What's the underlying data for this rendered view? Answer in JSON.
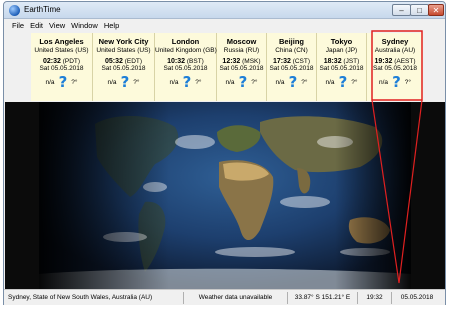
{
  "window": {
    "title": "EarthTime"
  },
  "menu": {
    "items": [
      "File",
      "Edit",
      "View",
      "Window",
      "Help"
    ]
  },
  "cities": [
    {
      "name": "Los Angeles",
      "country": "United States (US)",
      "time": "02:32",
      "zone": "(PDT)",
      "date": "Sat 05.05.2018",
      "weather": "n/a",
      "deg": "?°"
    },
    {
      "name": "New York City",
      "country": "United States (US)",
      "time": "05:32",
      "zone": "(EDT)",
      "date": "Sat 05.05.2018",
      "weather": "n/a",
      "deg": "?°"
    },
    {
      "name": "London",
      "country": "United Kingdom (GB)",
      "time": "10:32",
      "zone": "(BST)",
      "date": "Sat 05.05.2018",
      "weather": "n/a",
      "deg": "?°"
    },
    {
      "name": "Moscow",
      "country": "Russia (RU)",
      "time": "12:32",
      "zone": "(MSK)",
      "date": "Sat 05.05.2018",
      "weather": "n/a",
      "deg": "?°"
    },
    {
      "name": "Beijing",
      "country": "China (CN)",
      "time": "17:32",
      "zone": "(CST)",
      "date": "Sat 05.05.2018",
      "weather": "n/a",
      "deg": "?°"
    },
    {
      "name": "Tokyo",
      "country": "Japan (JP)",
      "time": "18:32",
      "zone": "(JST)",
      "date": "Sat 05.05.2018",
      "weather": "n/a",
      "deg": "?°"
    },
    {
      "name": "Sydney",
      "country": "Australia (AU)",
      "time": "19:32",
      "zone": "(AEST)",
      "date": "Sat 05.05.2018",
      "weather": "n/a",
      "deg": "?°"
    }
  ],
  "status": {
    "location": "Sydney, State of New South Wales, Australia (AU)",
    "weather": "Weather data unavailable",
    "coords": "33.87° S 151.21° E",
    "time": "19:32",
    "date": "05.05.2018"
  },
  "colors": {
    "highlight": "#e02020",
    "panel": "#fdfadb",
    "weather_icon": "#1e7fd8"
  }
}
